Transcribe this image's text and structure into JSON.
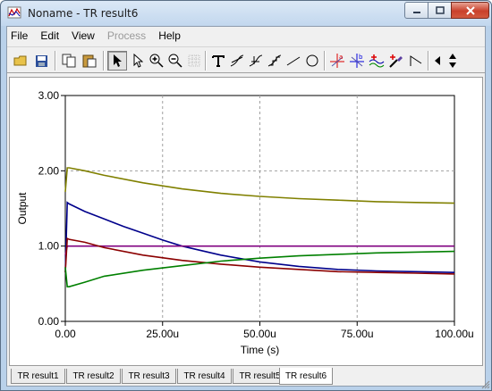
{
  "window": {
    "title": "Noname - TR result6",
    "app_icon": "chart-app-icon",
    "controls": {
      "minimize": "minimize-icon",
      "maximize": "maximize-icon",
      "close": "close-icon"
    }
  },
  "menu": [
    {
      "label": "File",
      "enabled": true
    },
    {
      "label": "Edit",
      "enabled": true
    },
    {
      "label": "View",
      "enabled": true
    },
    {
      "label": "Process",
      "enabled": false
    },
    {
      "label": "Help",
      "enabled": true
    }
  ],
  "toolbar": {
    "tools": [
      "open-icon",
      "save-icon",
      "copy-icon",
      "paste-icon",
      "pointer-icon",
      "arrow-select-icon",
      "zoom-in-icon",
      "zoom-100-icon",
      "grid-icon",
      "text-icon",
      "tangent-icon",
      "slope-icon",
      "step-icon",
      "line-icon",
      "circle-icon",
      "cursor-a-icon",
      "cursor-b-icon",
      "add-curve-icon",
      "pick-color-icon",
      "marker-icon",
      "scroll-left-icon",
      "scroll-updown-icon"
    ],
    "active_tool": "pointer-icon"
  },
  "chart_data": {
    "type": "line",
    "xlabel": "Time (s)",
    "ylabel": "Output",
    "xlim": [
      0,
      100
    ],
    "ylim": [
      0,
      3
    ],
    "xticks": [
      0,
      25,
      50,
      75,
      100
    ],
    "xtick_labels": [
      "0.00",
      "25.00u",
      "50.00u",
      "75.00u",
      "100.00u"
    ],
    "yticks": [
      0,
      1,
      2,
      3
    ],
    "ytick_labels": [
      "0.00",
      "1.00",
      "2.00",
      "3.00"
    ],
    "grid": true,
    "colors": [
      "#808000",
      "#00008b",
      "#800080",
      "#8b0000",
      "#008000"
    ],
    "series": [
      {
        "color": "#808000",
        "x": [
          0,
          0.5,
          1,
          5,
          10,
          20,
          30,
          40,
          50,
          60,
          70,
          80,
          90,
          100
        ],
        "y": [
          1.72,
          2.04,
          2.04,
          2.0,
          1.94,
          1.84,
          1.76,
          1.7,
          1.66,
          1.63,
          1.61,
          1.59,
          1.58,
          1.57
        ]
      },
      {
        "color": "#00008b",
        "x": [
          0,
          0.5,
          1,
          5,
          10,
          15,
          20,
          25,
          30,
          40,
          50,
          60,
          70,
          80,
          90,
          100
        ],
        "y": [
          0.65,
          1.58,
          1.56,
          1.46,
          1.36,
          1.26,
          1.17,
          1.08,
          1.0,
          0.88,
          0.79,
          0.73,
          0.69,
          0.67,
          0.66,
          0.65
        ]
      },
      {
        "color": "#800080",
        "x": [
          0,
          0.5,
          1,
          100
        ],
        "y": [
          0.88,
          1.0,
          1.0,
          1.0
        ]
      },
      {
        "color": "#8b0000",
        "x": [
          0,
          0.5,
          1,
          5,
          10,
          20,
          30,
          40,
          50,
          60,
          70,
          80,
          90,
          100
        ],
        "y": [
          0.65,
          1.1,
          1.09,
          1.05,
          0.98,
          0.88,
          0.81,
          0.76,
          0.72,
          0.69,
          0.66,
          0.65,
          0.64,
          0.63
        ]
      },
      {
        "color": "#008000",
        "x": [
          0,
          0.5,
          1,
          5,
          10,
          20,
          30,
          40,
          50,
          60,
          70,
          80,
          90,
          100
        ],
        "y": [
          0.72,
          0.46,
          0.46,
          0.52,
          0.6,
          0.68,
          0.74,
          0.8,
          0.84,
          0.87,
          0.89,
          0.91,
          0.92,
          0.93
        ]
      }
    ]
  },
  "tabs": [
    {
      "label": "TR result1",
      "active": false
    },
    {
      "label": "TR result2",
      "active": false
    },
    {
      "label": "TR result3",
      "active": false
    },
    {
      "label": "TR result4",
      "active": false
    },
    {
      "label": "TR result5",
      "active": false
    },
    {
      "label": "TR result6",
      "active": true
    }
  ]
}
